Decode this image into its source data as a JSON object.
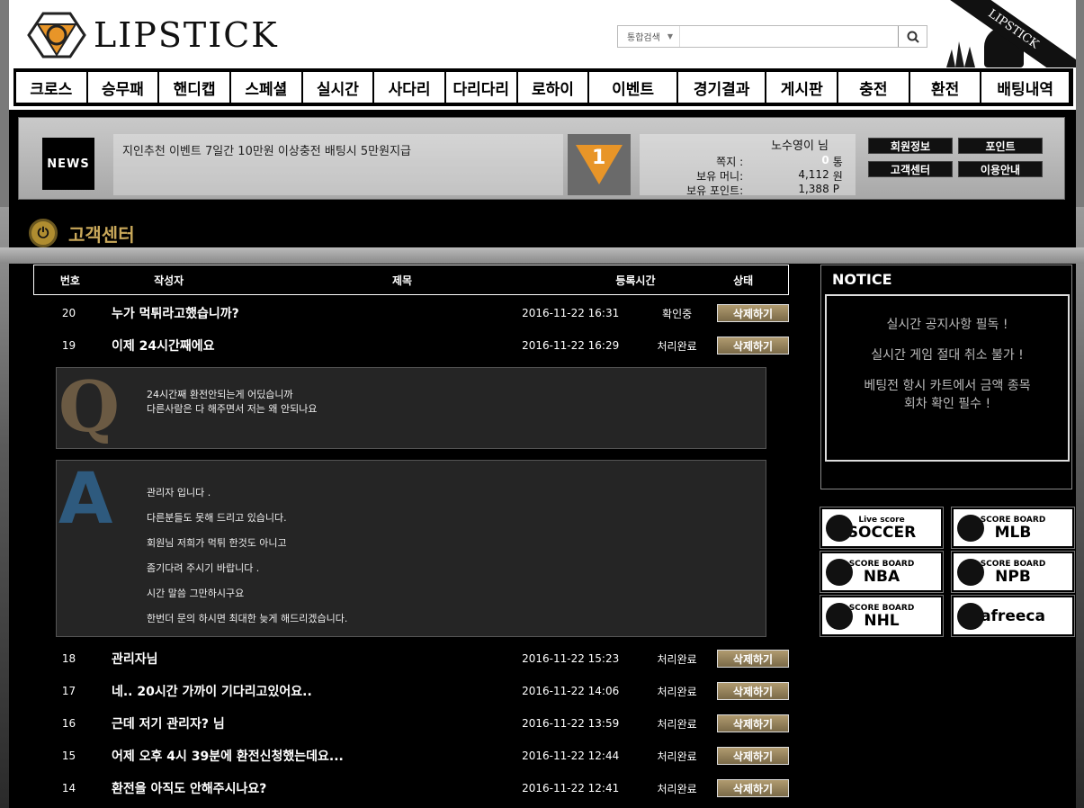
{
  "header": {
    "logo_text": "LIPSTICK",
    "corner_label": "LIPSTICK",
    "search": {
      "scope": "통합검색",
      "placeholder": "",
      "button_icon": "search-icon"
    }
  },
  "nav": [
    {
      "label": "크로스",
      "w": 82
    },
    {
      "label": "승무패",
      "w": 82
    },
    {
      "label": "핸디캡",
      "w": 82
    },
    {
      "label": "스페셜",
      "w": 82
    },
    {
      "label": "실시간",
      "w": 82
    },
    {
      "label": "사다리",
      "w": 82
    },
    {
      "label": "다리다리",
      "w": 82
    },
    {
      "label": "로하이",
      "w": 82
    },
    {
      "label": "이벤트",
      "w": 102
    },
    {
      "label": "경기결과",
      "w": 102
    },
    {
      "label": "게시판",
      "w": 82
    },
    {
      "label": "충전",
      "w": 82
    },
    {
      "label": "환전",
      "w": 82
    },
    {
      "label": "배팅내역",
      "w": 102
    }
  ],
  "news": {
    "label": "NEWS",
    "text": "지인추천 이벤트 7일간 10만원 이상충전 배팅시 5만원지급"
  },
  "user": {
    "rank_number": "1",
    "name": "노수영이 님",
    "rows": [
      {
        "label": "쪽지 :",
        "value": "0",
        "unit": "통"
      },
      {
        "label": "보유 머니:",
        "value": "4,112",
        "unit": "원"
      },
      {
        "label": "보유 포인트:",
        "value": "1,388",
        "unit": "P"
      }
    ],
    "buttons": [
      "회원정보",
      "포인트",
      "고객센터",
      "이용안내"
    ]
  },
  "page_title": "고객센터",
  "table": {
    "headers": [
      "번호",
      "작성자",
      "제목",
      "등록시간",
      "상태"
    ],
    "delete_label": "삭제하기",
    "rows_top": [
      {
        "no": "20",
        "title": "누가 먹튀라고했습니까?",
        "date": "2016-11-22 16:31",
        "status": "확인중"
      },
      {
        "no": "19",
        "title": "이제 24시간째에요",
        "date": "2016-11-22 16:29",
        "status": "처리완료"
      }
    ],
    "question": {
      "letter": "Q",
      "lines": [
        "24시간째 환전안되는게 어딨습니까",
        "다른사람은 다 해주면서 저는 왜 안되나요"
      ]
    },
    "answer": {
      "letter": "A",
      "lines": [
        "관리자 입니다 .",
        "다른분들도 못해 드리고 있습니다.",
        "회원님 저희가 먹튀 한것도 아니고",
        "좀기다려 주시기 바랍니다 .",
        "시간 말씀 그만하시구요",
        "한번더 문의 하시면 최대한 늦게 해드리겠습니다."
      ]
    },
    "rows_bottom": [
      {
        "no": "18",
        "title": "관리자님",
        "date": "2016-11-22 15:23",
        "status": "처리완료"
      },
      {
        "no": "17",
        "title": "네.. 20시간 가까이 기다리고있어요..",
        "date": "2016-11-22 14:06",
        "status": "처리완료"
      },
      {
        "no": "16",
        "title": "근데 저기 관리자? 님",
        "date": "2016-11-22 13:59",
        "status": "처리완료"
      },
      {
        "no": "15",
        "title": "어제 오후 4시 39분에 환전신청했는데요...",
        "date": "2016-11-22 12:44",
        "status": "처리완료"
      },
      {
        "no": "14",
        "title": "환전을 아직도 안해주시나요?",
        "date": "2016-11-22 12:41",
        "status": "처리완료"
      }
    ]
  },
  "notice": {
    "title": "NOTICE",
    "lines": [
      "실시간 공지사항 필독 !",
      "실시간 게임 절대 취소 불가 !",
      "베팅전 항시 카트에서 금액 종목\n회차 확인 필수 !"
    ]
  },
  "scoreboards": [
    {
      "small": "Live score",
      "big": "SOCCER",
      "icon": "soccer-ball-icon"
    },
    {
      "small": "SCORE BOARD",
      "big": "MLB",
      "icon": "mlb-logo-icon"
    },
    {
      "small": "SCORE BOARD",
      "big": "NBA",
      "icon": "nba-logo-icon"
    },
    {
      "small": "SCORE BOARD",
      "big": "NPB",
      "icon": "npb-logo-icon"
    },
    {
      "small": "SCORE BOARD",
      "big": "NHL",
      "icon": "nhl-logo-icon"
    },
    {
      "small": "",
      "big": "afreeca",
      "icon": "afreeca-mascot-icon"
    }
  ]
}
